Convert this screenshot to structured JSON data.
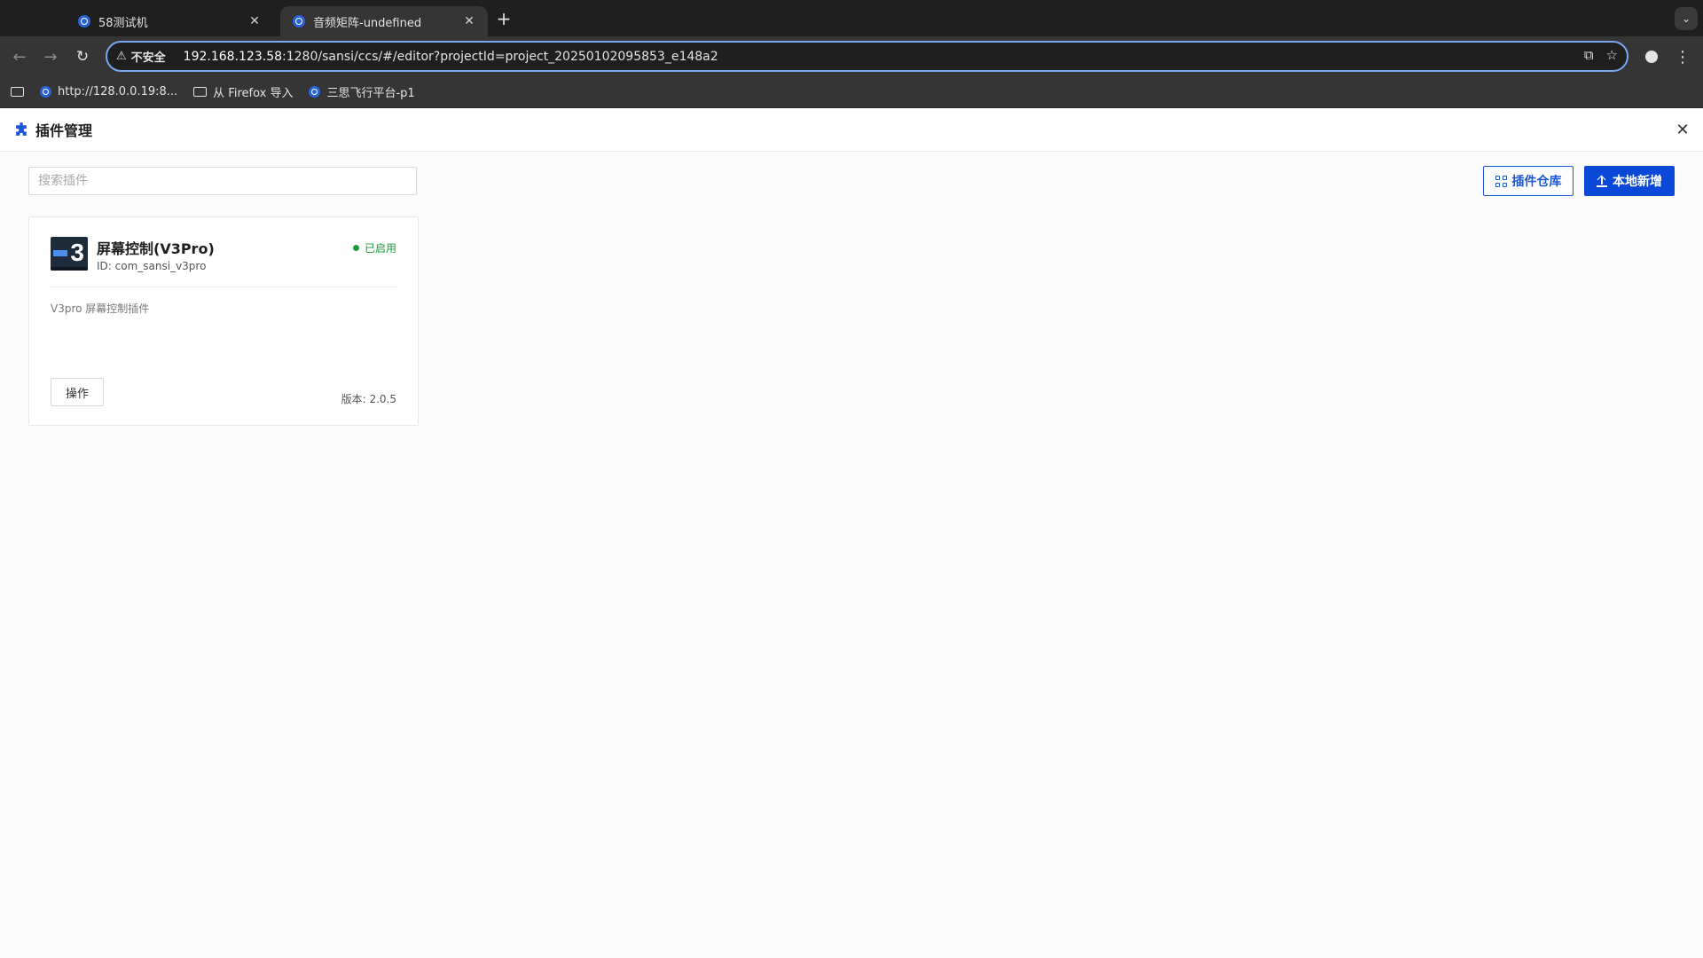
{
  "browser": {
    "tabs": [
      {
        "title": "58测试机",
        "active": false
      },
      {
        "title": "音频矩阵-undefined",
        "active": true
      }
    ],
    "address": {
      "security_label": "不安全",
      "url_host": "192.168.123.58",
      "url_rest": ":1280/sansi/ccs/#/editor?projectId=project_20250102095853_e148a2"
    },
    "bookmarks": [
      {
        "label": "http://128.0.0.19:8...",
        "kind": "site"
      },
      {
        "label": "从 Firefox 导入",
        "kind": "folder"
      },
      {
        "label": "三思飞行平台-p1",
        "kind": "site"
      }
    ]
  },
  "dialog": {
    "title": "插件管理",
    "search_placeholder": "搜索插件",
    "repo_button": "插件仓库",
    "add_button": "本地新增"
  },
  "plugins": [
    {
      "name": "屏幕控制(V3Pro)",
      "id_text": "ID: com_sansi_v3pro",
      "status": "已启用",
      "description": "V3pro 屏幕控制插件",
      "action_label": "操作",
      "version_text": "版本: 2.0.5"
    }
  ],
  "colors": {
    "accent": "#0a49d8",
    "status_enabled": "#1f9a3b"
  },
  "icons": {
    "dialog_title": "puzzle-icon",
    "repo_button": "grid-icon",
    "add_button": "upload-icon",
    "close": "close-icon"
  }
}
